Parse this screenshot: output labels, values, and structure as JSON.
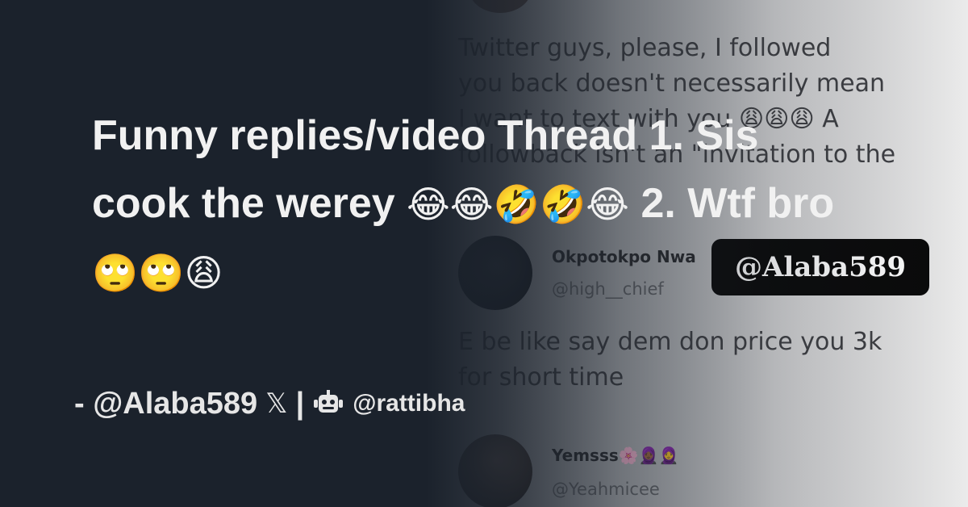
{
  "backdrop": {
    "tweet_top_text": "Twitter guys, please, I followed\nyou back doesn't necessarily mean\nI want to text with you 😩😩😩 A\nfollowback isn't an \"invitation to the",
    "reply1_name": "Okpotokpo Nwa",
    "reply1_handle": "@high__chief",
    "reply1_text": "E be like say dem don price you 3k\nfor short time",
    "reply2_name": "Yemsss🌸🧕🏾🧕",
    "reply2_handle": "@Yeahmicee",
    "watermark": "@Alaba589"
  },
  "headline": {
    "text": "Funny replies/video Thread 1. Sis cook the werey",
    "emojis_1": "😂😂🤣🤣😂",
    "text_2": "2. Wtf bro",
    "emojis_2": "🙄🙄😩"
  },
  "footer": {
    "author": "- @Alaba589",
    "x_icon": "𝕏",
    "separator": "|",
    "bot_icon": "robot-icon",
    "credit": "@rattibha"
  }
}
